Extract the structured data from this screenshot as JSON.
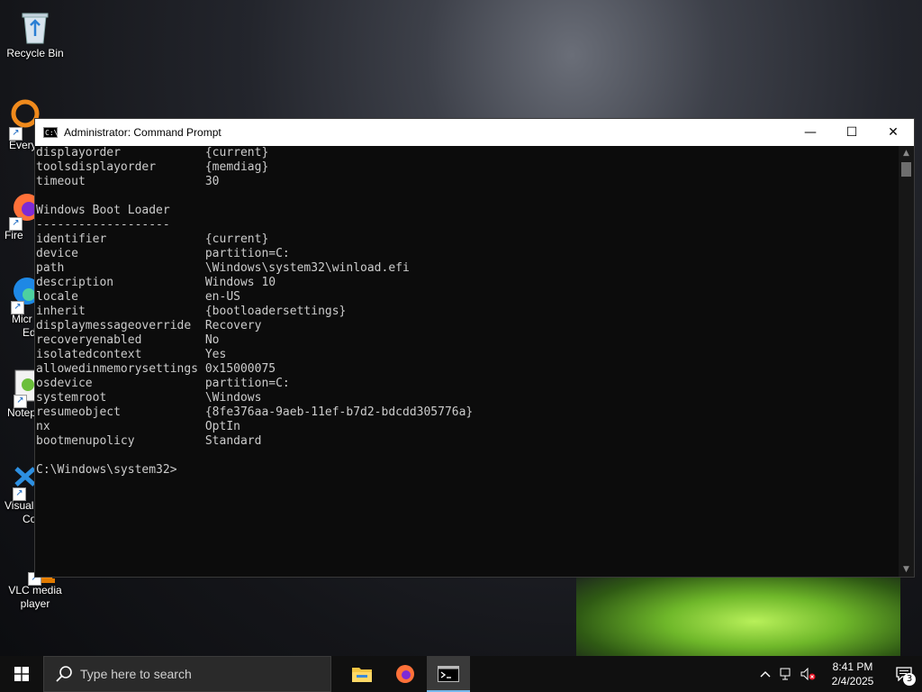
{
  "desktop": {
    "icons": [
      {
        "label": "Recycle Bin"
      },
      {
        "label": "Every"
      },
      {
        "label": "Fire"
      },
      {
        "label": "Micr"
      },
      {
        "label": "Ed"
      },
      {
        "label": "Notep"
      },
      {
        "label": "Visual"
      },
      {
        "label": "Co"
      },
      {
        "label": "VLC media"
      },
      {
        "label": "player"
      }
    ]
  },
  "window": {
    "title": "Administrator: Command Prompt",
    "title_icon_text": "C:\\_",
    "buttons": {
      "minimize": "—",
      "maximize": "☐",
      "close": "✕"
    },
    "lines": [
      "displayorder            {current}",
      "toolsdisplayorder       {memdiag}",
      "timeout                 30",
      "",
      "Windows Boot Loader",
      "-------------------",
      "identifier              {current}",
      "device                  partition=C:",
      "path                    \\Windows\\system32\\winload.efi",
      "description             Windows 10",
      "locale                  en-US",
      "inherit                 {bootloadersettings}",
      "displaymessageoverride  Recovery",
      "recoveryenabled         No",
      "isolatedcontext         Yes",
      "allowedinmemorysettings 0x15000075",
      "osdevice                partition=C:",
      "systemroot              \\Windows",
      "resumeobject            {8fe376aa-9aeb-11ef-b7d2-bdcdd305776a}",
      "nx                      OptIn",
      "bootmenupolicy          Standard",
      "",
      "C:\\Windows\\system32>"
    ]
  },
  "taskbar": {
    "search_placeholder": "Type here to search",
    "apps": [
      {
        "name": "file-explorer-icon"
      },
      {
        "name": "firefox-icon"
      },
      {
        "name": "command-prompt-icon"
      }
    ],
    "time": "8:41 PM",
    "date": "2/4/2025",
    "notification_count": "3",
    "colors": {
      "taskbar": "#101010",
      "active_indicator": "#76b9ed"
    }
  }
}
